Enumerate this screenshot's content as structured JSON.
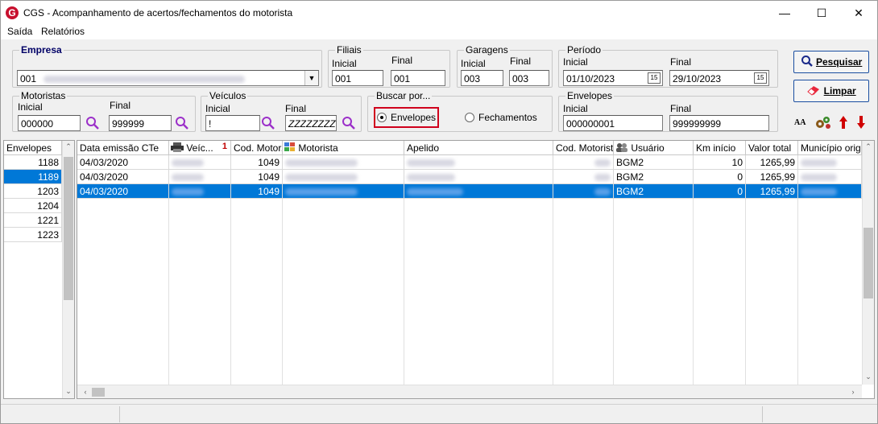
{
  "window": {
    "title": "CGS - Acompanhamento de acertos/fechamentos do motorista",
    "minimize": "—",
    "maximize": "☐",
    "close": "✕",
    "icon_letter": "G"
  },
  "menu": {
    "items": [
      "Saída",
      "Relatórios"
    ]
  },
  "empresa": {
    "legend": "Empresa",
    "value_code": "001"
  },
  "filiais": {
    "legend": "Filiais",
    "inicial_label": "Inicial",
    "final_label": "Final",
    "inicial": "001",
    "final": "001"
  },
  "garagens": {
    "legend": "Garagens",
    "inicial_label": "Inicial",
    "final_label": "Final",
    "inicial": "003",
    "final": "003"
  },
  "periodo": {
    "legend": "Período",
    "inicial_label": "Inicial",
    "final_label": "Final",
    "inicial": "01/10/2023",
    "final": "29/10/2023",
    "cal_label": "15"
  },
  "motoristas": {
    "legend": "Motoristas",
    "inicial_label": "Inicial",
    "final_label": "Final",
    "inicial": "000000",
    "final": "999999"
  },
  "veiculos": {
    "legend": "Veículos",
    "inicial_label": "Inicial",
    "final_label": "Final",
    "inicial": "!",
    "final": "ZZZZZZZZ"
  },
  "buscar": {
    "legend": "Buscar por...",
    "option1": "Envelopes",
    "option2": "Fechamentos",
    "selected": "Envelopes"
  },
  "envelopes_range": {
    "legend": "Envelopes",
    "inicial_label": "Inicial",
    "final_label": "Final",
    "inicial": "000000001",
    "final": "999999999"
  },
  "buttons": {
    "pesquisar": "Pesquisar",
    "limpar": "Limpar",
    "font_tool": "AA"
  },
  "colors": {
    "accent": "#0078d7",
    "highlight_border": "#d0001c",
    "search_icon": "#9b2fc9",
    "arrow_red": "#d00000"
  },
  "envelopes_list": {
    "header": "Envelopes",
    "items": [
      "1188",
      "1189",
      "1203",
      "1204",
      "1221",
      "1223"
    ],
    "selected_index": 1
  },
  "grid": {
    "headers": [
      "Data emissão CTe",
      "Veíc...",
      "Cod. Motor...",
      "Motorista",
      "Apelido",
      "Cod. Motorista",
      "Usuário",
      "Km início",
      "Valor total",
      "Município origer"
    ],
    "rows": [
      {
        "data": "04/03/2020",
        "cod_motor": "1049",
        "usuario": "BGM2",
        "km_inicio": "10",
        "valor_total": "1265,99"
      },
      {
        "data": "04/03/2020",
        "cod_motor": "1049",
        "usuario": "BGM2",
        "km_inicio": "0",
        "valor_total": "1265,99"
      },
      {
        "data": "04/03/2020",
        "cod_motor": "1049",
        "usuario": "BGM2",
        "km_inicio": "0",
        "valor_total": "1265,99"
      }
    ],
    "selected_row": 2
  }
}
